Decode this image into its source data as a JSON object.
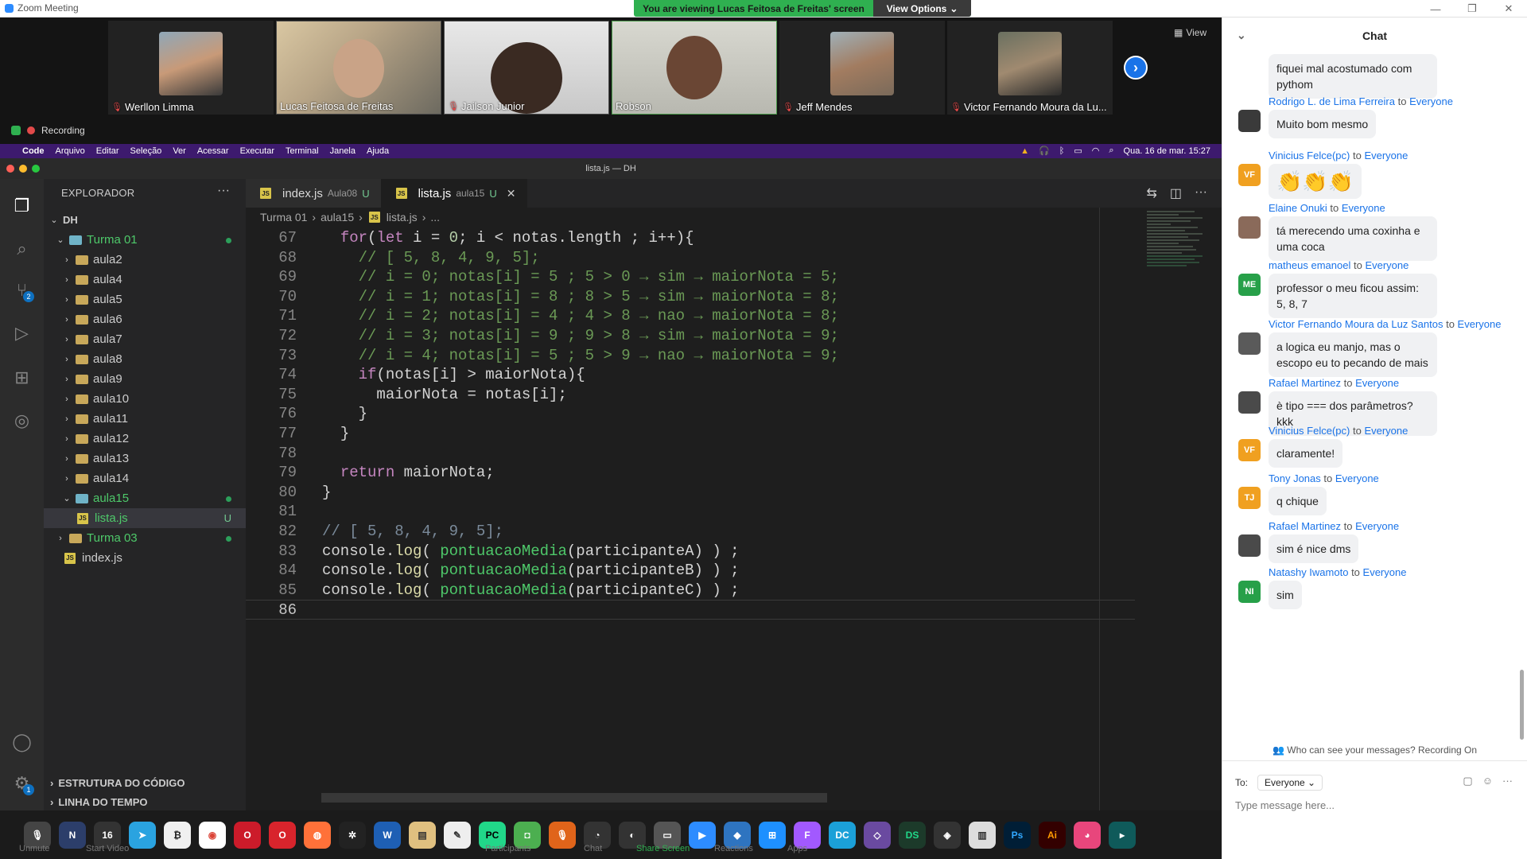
{
  "zoom": {
    "window_title": "Zoom Meeting",
    "viewing_banner": "You are viewing Lucas Feitosa de Freitas' screen",
    "view_options_label": "View Options",
    "view_label": "View",
    "recording_label": "Recording",
    "participants": [
      {
        "name": "Werllon Limma",
        "muted": true
      },
      {
        "name": "Lucas Feitosa de Freitas",
        "muted": false
      },
      {
        "name": "Jailson Junior",
        "muted": true
      },
      {
        "name": "Robson",
        "muted": false
      },
      {
        "name": "Jeff Mendes",
        "muted": true
      },
      {
        "name": "Victor Fernando Moura da Lu...",
        "muted": true
      }
    ]
  },
  "mac": {
    "menus": [
      "Code",
      "Arquivo",
      "Editar",
      "Seleção",
      "Ver",
      "Acessar",
      "Executar",
      "Terminal",
      "Janela",
      "Ajuda"
    ],
    "clock": "Qua. 16 de mar. 15:27"
  },
  "vscode": {
    "window_title": "lista.js — DH",
    "explorer_title": "EXPLORADOR",
    "root": "DH",
    "tree": [
      {
        "label": "Turma 01",
        "type": "folder",
        "depth": 1,
        "open": true,
        "green": true,
        "dot": true
      },
      {
        "label": "aula2",
        "type": "folder",
        "depth": 2
      },
      {
        "label": "aula4",
        "type": "folder",
        "depth": 2
      },
      {
        "label": "aula5",
        "type": "folder",
        "depth": 2
      },
      {
        "label": "aula6",
        "type": "folder",
        "depth": 2
      },
      {
        "label": "aula7",
        "type": "folder",
        "depth": 2
      },
      {
        "label": "aula8",
        "type": "folder",
        "depth": 2
      },
      {
        "label": "aula9",
        "type": "folder",
        "depth": 2
      },
      {
        "label": "aula10",
        "type": "folder",
        "depth": 2
      },
      {
        "label": "aula11",
        "type": "folder",
        "depth": 2
      },
      {
        "label": "aula12",
        "type": "folder",
        "depth": 2
      },
      {
        "label": "aula13",
        "type": "folder",
        "depth": 2
      },
      {
        "label": "aula14",
        "type": "folder",
        "depth": 2
      },
      {
        "label": "aula15",
        "type": "folder",
        "depth": 2,
        "open": true,
        "green": true,
        "dot": true
      },
      {
        "label": "lista.js",
        "type": "file",
        "depth": 3,
        "green": true,
        "selected": true,
        "u": "U"
      },
      {
        "label": "Turma 03",
        "type": "folder",
        "depth": 1,
        "green": true,
        "dot": true
      },
      {
        "label": "index.js",
        "type": "file",
        "depth": 1
      }
    ],
    "outline_label": "ESTRUTURA DO CÓDIGO",
    "timeline_label": "LINHA DO TEMPO",
    "tabs": [
      {
        "name": "index.js",
        "folder": "Aula08",
        "status": "U",
        "active": false
      },
      {
        "name": "lista.js",
        "folder": "aula15",
        "status": "U",
        "active": true
      }
    ],
    "breadcrumb": [
      "Turma 01",
      "aula15",
      "lista.js",
      "..."
    ],
    "code_lines": [
      {
        "n": "67",
        "indent": "  ",
        "tokens": [
          [
            "kw",
            "for"
          ],
          [
            "plain",
            "("
          ],
          [
            "kw",
            "let"
          ],
          [
            "plain",
            " i = "
          ],
          [
            "num",
            "0"
          ],
          [
            "plain",
            "; i < notas.length ; i++){"
          ]
        ]
      },
      {
        "n": "68",
        "indent": "    ",
        "tokens": [
          [
            "cm",
            "// [ 5, 8, 4, 9, 5];"
          ]
        ]
      },
      {
        "n": "69",
        "indent": "    ",
        "tokens": [
          [
            "cm",
            "// i = 0; notas[i] = 5 ; 5 > 0 → sim → maiorNota = 5;"
          ]
        ]
      },
      {
        "n": "70",
        "indent": "    ",
        "tokens": [
          [
            "cm",
            "// i = 1; notas[i] = 8 ; 8 > 5 → sim → maiorNota = 8;"
          ]
        ]
      },
      {
        "n": "71",
        "indent": "    ",
        "tokens": [
          [
            "cm",
            "// i = 2; notas[i] = 4 ; 4 > 8 → nao → maiorNota = 8;"
          ]
        ]
      },
      {
        "n": "72",
        "indent": "    ",
        "tokens": [
          [
            "cm",
            "// i = 3; notas[i] = 9 ; 9 > 8 → sim → maiorNota = 9;"
          ]
        ]
      },
      {
        "n": "73",
        "indent": "    ",
        "tokens": [
          [
            "cm",
            "// i = 4; notas[i] = 5 ; 5 > 9 → nao → maiorNota = 9;"
          ]
        ]
      },
      {
        "n": "74",
        "indent": "    ",
        "tokens": [
          [
            "kw",
            "if"
          ],
          [
            "plain",
            "(notas[i] > maiorNota){"
          ]
        ]
      },
      {
        "n": "75",
        "indent": "      ",
        "tokens": [
          [
            "plain",
            "maiorNota = notas[i];"
          ]
        ]
      },
      {
        "n": "76",
        "indent": "    ",
        "tokens": [
          [
            "plain",
            "}"
          ]
        ]
      },
      {
        "n": "77",
        "indent": "  ",
        "tokens": [
          [
            "plain",
            "}"
          ]
        ]
      },
      {
        "n": "78",
        "indent": "",
        "tokens": []
      },
      {
        "n": "79",
        "indent": "  ",
        "tokens": [
          [
            "kw",
            "return"
          ],
          [
            "plain",
            " maiorNota;"
          ]
        ]
      },
      {
        "n": "80",
        "indent": "",
        "tokens": [
          [
            "plain",
            "}"
          ]
        ]
      },
      {
        "n": "81",
        "indent": "",
        "tokens": []
      },
      {
        "n": "82",
        "indent": "",
        "tokens": [
          [
            "cm2",
            "// [ 5, 8, 4, 9, 5];"
          ]
        ]
      },
      {
        "n": "83",
        "indent": "",
        "tokens": [
          [
            "plain",
            "console."
          ],
          [
            "fn",
            "log"
          ],
          [
            "plain",
            "( "
          ],
          [
            "fn2",
            "pontuacaoMedia"
          ],
          [
            "plain",
            "(participanteA) ) ;"
          ]
        ]
      },
      {
        "n": "84",
        "indent": "",
        "tokens": [
          [
            "plain",
            "console."
          ],
          [
            "fn",
            "log"
          ],
          [
            "plain",
            "( "
          ],
          [
            "fn2",
            "pontuacaoMedia"
          ],
          [
            "plain",
            "(participanteB) ) ;"
          ]
        ]
      },
      {
        "n": "85",
        "indent": "",
        "tokens": [
          [
            "plain",
            "console."
          ],
          [
            "fn",
            "log"
          ],
          [
            "plain",
            "( "
          ],
          [
            "fn2",
            "pontuacaoMedia"
          ],
          [
            "plain",
            "(participanteC) ) ;"
          ]
        ]
      },
      {
        "n": "86",
        "indent": "",
        "tokens": [],
        "current": true
      }
    ]
  },
  "dock_labels": {
    "unmute": "Unmute",
    "start_video": "Start Video",
    "participants": "Participants",
    "chat": "Chat",
    "share_screen": "Share Screen",
    "reactions": "Reactions",
    "apps": "Apps"
  },
  "chat": {
    "title": "Chat",
    "messages": [
      {
        "from": "",
        "to": "",
        "avatar": "",
        "avatar_color": "",
        "text": "fiquei mal acostumado com pythom"
      },
      {
        "from": "Rodrigo L. de Lima Ferreira",
        "to": "Everyone",
        "avatar": "",
        "avatar_color": "#3a3a3a",
        "text": "Muito bom mesmo"
      },
      {
        "from": "Vinicius Felce(pc)",
        "to": "Everyone",
        "avatar": "VF",
        "avatar_color": "#f0a020",
        "text": "👏👏👏"
      },
      {
        "from": "Elaine Onuki",
        "to": "Everyone",
        "avatar": "",
        "avatar_color": "#8a6a5a",
        "text": "tá merecendo uma coxinha e uma coca"
      },
      {
        "from": "matheus emanoel",
        "to": "Everyone",
        "avatar": "ME",
        "avatar_color": "#27a049",
        "text": "professor o meu ficou assim: 5, 8, 7"
      },
      {
        "from": "Victor Fernando Moura da Luz Santos",
        "to": "Everyone",
        "avatar": "",
        "avatar_color": "#5a5a5a",
        "text": "a logica eu manjo, mas o escopo eu to pecando de mais"
      },
      {
        "from": "Rafael Martinez",
        "to": "Everyone",
        "avatar": "",
        "avatar_color": "#4a4a4a",
        "text": "è tipo === dos parâmetros? kkk"
      },
      {
        "from": "Vinicius Felce(pc)",
        "to": "Everyone",
        "avatar": "VF",
        "avatar_color": "#f0a020",
        "text": "claramente!"
      },
      {
        "from": "Tony Jonas",
        "to": "Everyone",
        "avatar": "TJ",
        "avatar_color": "#f0a020",
        "text": "q chique"
      },
      {
        "from": "Rafael Martinez",
        "to": "Everyone",
        "avatar": "",
        "avatar_color": "#4a4a4a",
        "text": "sim é nice dms"
      },
      {
        "from": "Natashy Iwamoto",
        "to": "Everyone",
        "avatar": "NI",
        "avatar_color": "#27a049",
        "text": "sim"
      }
    ],
    "to_word": "to",
    "info": "Who can see your messages? Recording On",
    "to_label": "To:",
    "to_value": "Everyone",
    "input_placeholder": "Type message here..."
  }
}
